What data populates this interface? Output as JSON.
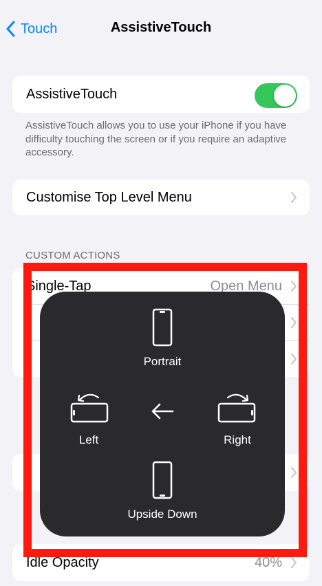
{
  "nav": {
    "back_label": "Touch",
    "title": "AssistiveTouch"
  },
  "main_toggle": {
    "label": "AssistiveTouch",
    "state": "on",
    "color": "#34c759"
  },
  "description": "AssistiveTouch allows you to use your iPhone if you have difficulty touching the screen or if you require an adaptive accessory.",
  "customise_menu": {
    "label": "Customise Top Level Menu"
  },
  "custom_actions": {
    "header": "CUSTOM ACTIONS",
    "single_tap": {
      "label": "Single-Tap",
      "value": "Open Menu"
    }
  },
  "idle_opacity": {
    "label": "Idle Opacity",
    "value": "40%"
  },
  "rotate_menu": {
    "portrait": "Portrait",
    "left": "Left",
    "right": "Right",
    "upside_down": "Upside Down"
  },
  "colors": {
    "accent": "#0a84ff",
    "highlight": "#ff1a0f",
    "menu_bg": "#2a2a2c"
  }
}
